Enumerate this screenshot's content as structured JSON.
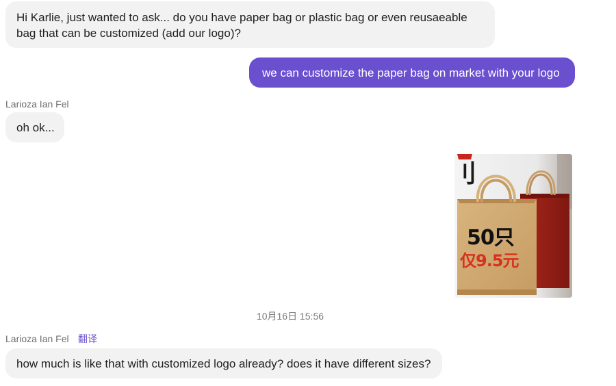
{
  "messages": [
    {
      "direction": "incoming",
      "text": "Hi Karlie, just wanted to ask... do you have paper bag or plastic bag or even reusaeable bag that can be customized (add our logo)?"
    },
    {
      "direction": "outgoing",
      "text": "we can customize the paper bag on market with your logo"
    },
    {
      "direction": "incoming",
      "sender": "Larioza Ian Fel",
      "text": "oh ok..."
    },
    {
      "direction": "outgoing",
      "type": "image",
      "image": {
        "big_text": "50只",
        "price_text": "仅9.5元",
        "partial_text": "刂"
      }
    },
    {
      "type": "timestamp",
      "text": "10月16日 15:56"
    },
    {
      "direction": "incoming",
      "sender": "Larioza Ian Fel",
      "translate_label": "翻译",
      "text": "how much is like that with customized logo already? does it have different sizes?"
    }
  ],
  "colors": {
    "outgoing_bubble": "#6a4fcf",
    "incoming_bubble": "#f2f2f3",
    "translate_link": "#6a4fcf"
  }
}
